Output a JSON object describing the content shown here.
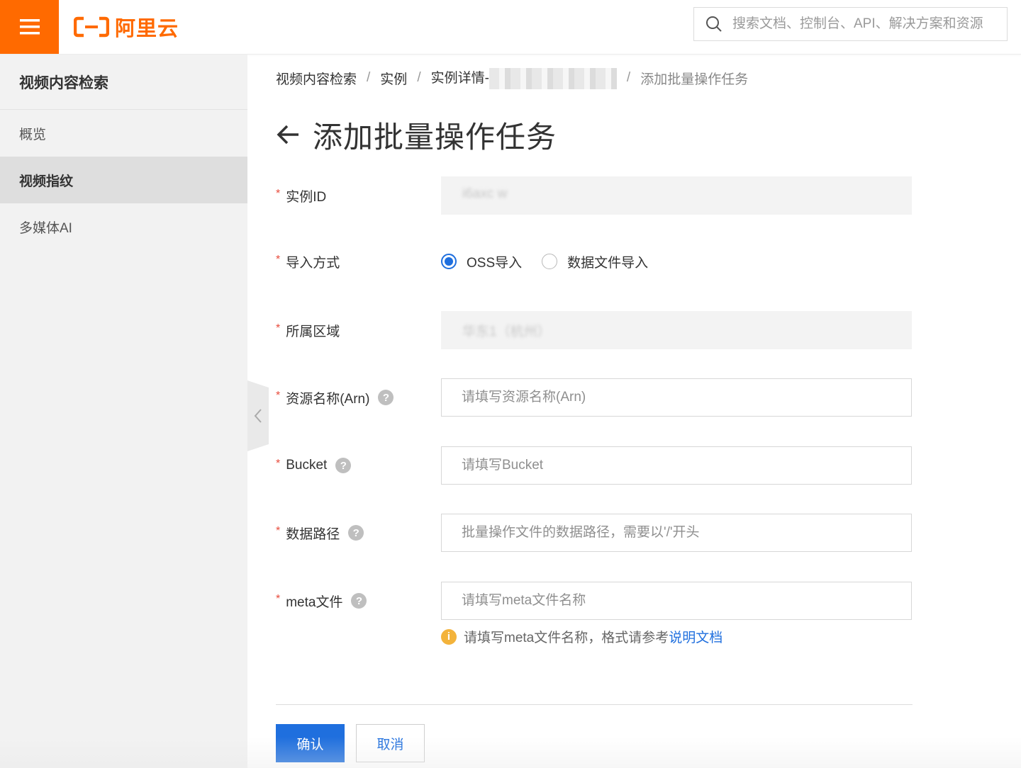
{
  "header": {
    "logo_text": "阿里云",
    "search": {
      "placeholder": "搜索文档、控制台、API、解决方案和资源"
    },
    "brand_color": "#ff6a00"
  },
  "sidebar": {
    "title": "视频内容检索",
    "items": [
      {
        "label": "概览",
        "active": false
      },
      {
        "label": "视频指纹",
        "active": true
      },
      {
        "label": "多媒体AI",
        "active": false
      }
    ]
  },
  "breadcrumb": {
    "items": [
      "视频内容检索",
      "实例",
      "实例详情-"
    ],
    "separator": "/",
    "current": "添加批量操作任务"
  },
  "page": {
    "title": "添加批量操作任务"
  },
  "form": {
    "instance_id": {
      "label": "实例ID",
      "value": "i6axc w"
    },
    "import_method": {
      "label": "导入方式",
      "options": [
        {
          "label": "OSS导入",
          "checked": true
        },
        {
          "label": "数据文件导入",
          "checked": false
        }
      ]
    },
    "region": {
      "label": "所属区域",
      "value": "华东1（杭州）"
    },
    "arn": {
      "label": "资源名称(Arn)",
      "placeholder": "请填写资源名称(Arn)"
    },
    "bucket": {
      "label": "Bucket",
      "placeholder": "请填写Bucket"
    },
    "data_path": {
      "label": "数据路径",
      "placeholder": "批量操作文件的数据路径，需要以'/'开头"
    },
    "meta_file": {
      "label": "meta文件",
      "placeholder": "请填写meta文件名称",
      "hint_text": "请填写meta文件名称，格式请参考",
      "hint_link": "说明文档"
    },
    "required_mark": "*",
    "help_mark": "?",
    "info_mark": "i"
  },
  "actions": {
    "confirm": "确认",
    "cancel": "取消"
  },
  "colors": {
    "primary": "#1f6fde",
    "required": "#e84c3d",
    "warning": "#f3b33b"
  }
}
